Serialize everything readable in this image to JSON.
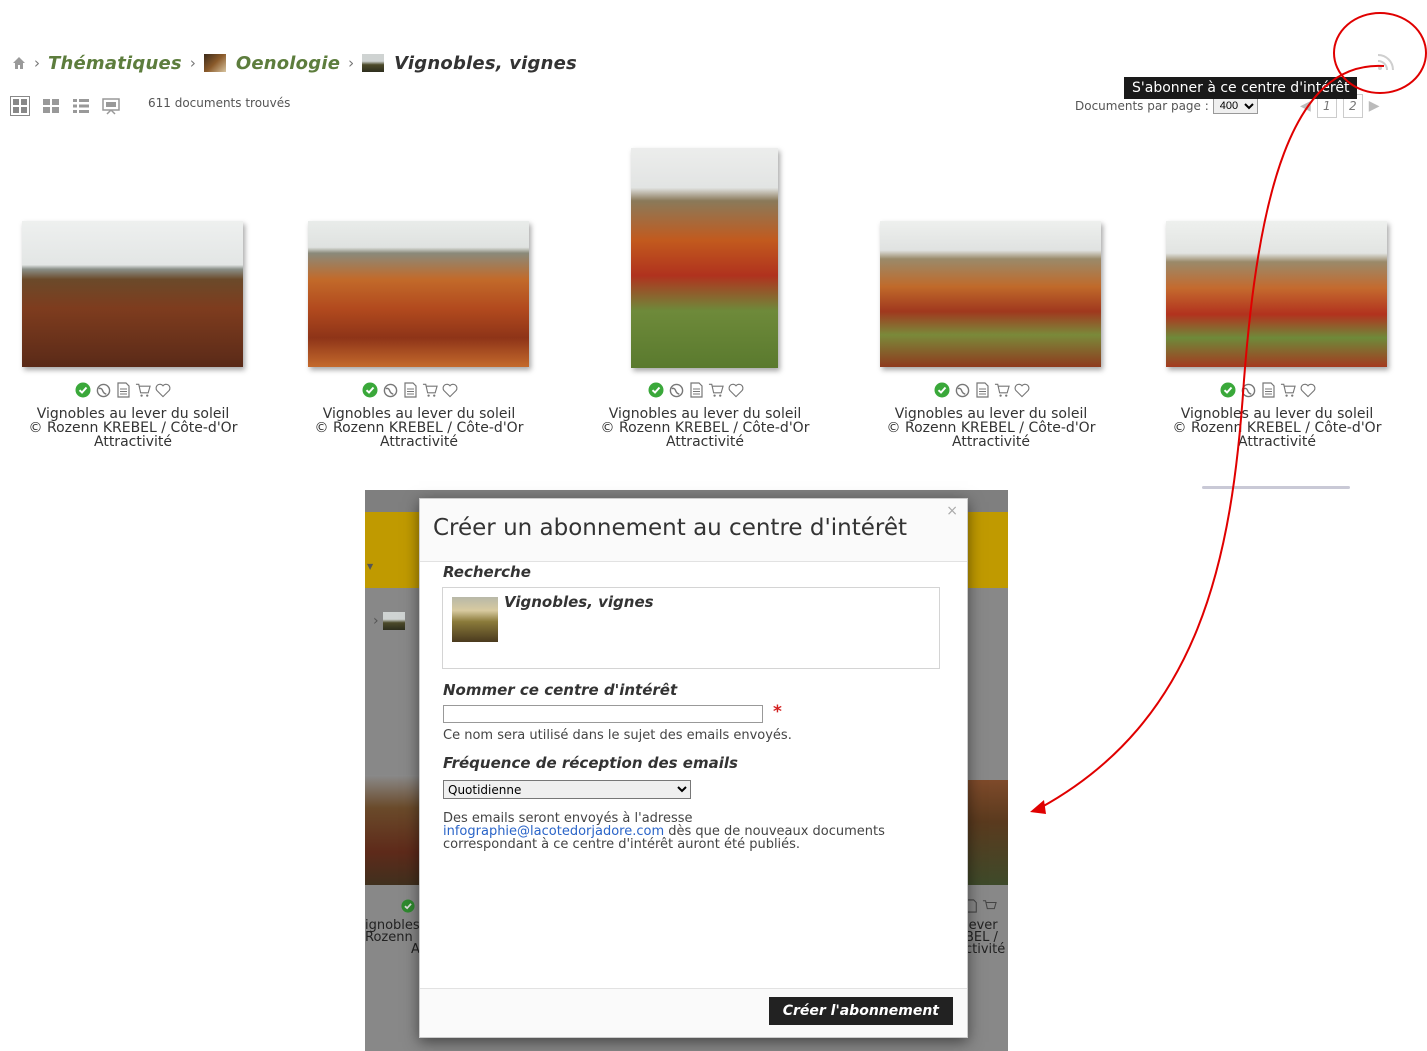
{
  "breadcrumb": {
    "items": [
      {
        "label": "Thématiques"
      },
      {
        "label": "Oenologie"
      },
      {
        "label": "Vignobles, vignes"
      }
    ]
  },
  "toolbar": {
    "docs_count": "611 documents trouvés",
    "per_page_label": "Documents par page :",
    "per_page_value": "400",
    "pages": [
      "1",
      "2"
    ],
    "rss_tooltip": "S'abonner à ce centre d'intérêt"
  },
  "gallery": {
    "items": [
      {
        "title": "Vignobles au lever du soleil",
        "credit": "© Rozenn KREBEL / Côte-d'Or",
        "credit2": "Attractivité"
      },
      {
        "title": "Vignobles au lever du soleil",
        "credit": "© Rozenn KREBEL / Côte-d'Or",
        "credit2": "Attractivité"
      },
      {
        "title": "Vignobles au lever du soleil",
        "credit": "© Rozenn KREBEL / Côte-d'Or",
        "credit2": "Attractivité"
      },
      {
        "title": "Vignobles au lever du soleil",
        "credit": "© Rozenn KREBEL / Côte-d'Or",
        "credit2": "Attractivité"
      },
      {
        "title": "Vignobles au lever du soleil",
        "credit": "© Rozenn KREBEL / Côte-d'Or",
        "credit2": "Attractivité"
      }
    ],
    "item_icons": [
      "check-circle-icon",
      "globe-icon",
      "document-icon",
      "cart-icon",
      "heart-icon"
    ]
  },
  "background_page": {
    "left_text": [
      "ignobles",
      "Rozenn",
      "A"
    ],
    "right_text": [
      "lever",
      "BEL /",
      "ctivité"
    ]
  },
  "modal": {
    "title": "Créer un abonnement au centre d'intérêt",
    "close": "×",
    "search_section": "Recherche",
    "search_value": "Vignobles, vignes",
    "name_section": "Nommer ce centre d'intérêt",
    "name_value": "",
    "required_mark": "*",
    "name_hint": "Ce nom sera utilisé dans le sujet des emails envoyés.",
    "frequency_section": "Fréquence de réception des emails",
    "frequency_value": "Quotidienne",
    "email_note_1": "Des emails seront envoyés à l'adresse",
    "email_address": "infographie@lacotedorjadore.com",
    "email_note_2": " dès que de nouveaux documents",
    "email_note_3": "correspondant à ce centre d'intérêt auront été publiés.",
    "submit_label": "Créer l'abonnement"
  },
  "colors": {
    "breadcrumb_link": "#5d7d3d",
    "annotation": "#e00000",
    "banner_yellow": "#c09a00",
    "required": "#d32020",
    "link": "#2a64c8"
  }
}
